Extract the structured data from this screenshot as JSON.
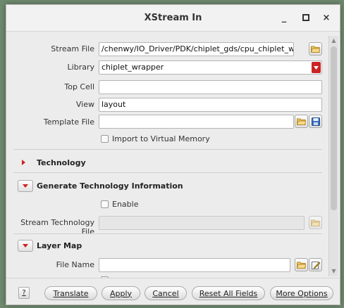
{
  "window": {
    "title": "XStream In",
    "minimize_glyph": "_",
    "maximize_glyph": "□",
    "close_glyph": "×"
  },
  "form": {
    "stream_file": {
      "label": "Stream File",
      "value": "/chenwy/IO_Driver/PDK/chiplet_gds/cpu_chiplet_wrapper.gds",
      "icon": "folder-open-icon"
    },
    "library": {
      "label": "Library",
      "value": "chiplet_wrapper",
      "icon": "dropdown-arrow-icon"
    },
    "top_cell": {
      "label": "Top Cell",
      "value": ""
    },
    "view": {
      "label": "View",
      "value": "layout"
    },
    "template_file": {
      "label": "Template File",
      "value": "",
      "icons": [
        "folder-open-icon",
        "save-icon"
      ]
    },
    "import_virtual_memory": {
      "label": "Import to Virtual Memory",
      "checked": false
    }
  },
  "sections": {
    "technology": {
      "title": "Technology",
      "expanded": false
    },
    "generate_tech": {
      "title": "Generate Technology Information",
      "expanded": true,
      "enable_label": "Enable",
      "enable_checked": false,
      "stream_tech_file_label": "Stream Technology File",
      "stream_tech_file_value": ""
    },
    "layer_map": {
      "title": "Layer Map",
      "expanded": true,
      "file_name_label": "File Name",
      "file_name_value": "",
      "icons": [
        "folder-open-icon",
        "edit-icon"
      ]
    }
  },
  "buttons": {
    "help": "?",
    "translate": "Translate",
    "apply": "Apply",
    "cancel": "Cancel",
    "reset": "Reset All Fields",
    "more": "More Options"
  },
  "colors": {
    "accent_red": "#cc2323",
    "background": "#ececec",
    "desktop": "#6f8a6e"
  }
}
